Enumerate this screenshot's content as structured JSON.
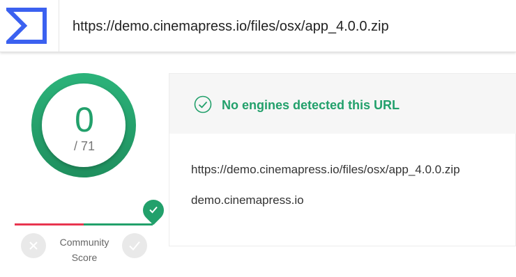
{
  "header": {
    "logo_icon": "virustotal-sigma-logo-icon",
    "url_value": "https://demo.cinemapress.io/files/osx/app_4.0.0.zip"
  },
  "score": {
    "detections": "0",
    "total": "/ 71",
    "ring_color": "#22a06b"
  },
  "community": {
    "label_line1": "Community",
    "label_line2": "Score",
    "down_icon": "close-icon",
    "up_icon": "check-icon",
    "negative_color": "#e8354f",
    "positive_color": "#22a06b"
  },
  "result": {
    "status_icon": "check-circle-icon",
    "status_text": "No engines detected this URL",
    "url": "https://demo.cinemapress.io/files/osx/app_4.0.0.zip",
    "domain": "demo.cinemapress.io"
  }
}
